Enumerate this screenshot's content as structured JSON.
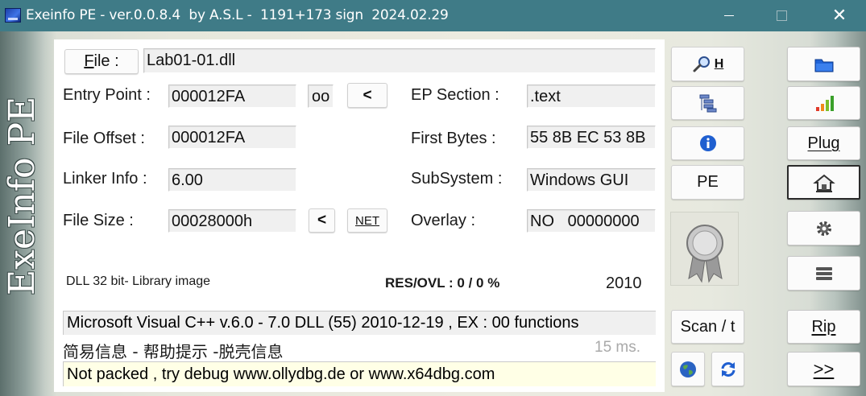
{
  "window": {
    "title": "Exeinfo PE - ver.0.0.8.4  by A.S.L -  1191+173 sign  2024.02.29",
    "controls": {
      "minimize": "minimize",
      "maximize": "maximize",
      "close": "✕"
    }
  },
  "logo_text": "ExeInfo PE",
  "file": {
    "button_label": "File :",
    "button_hotkey": "F",
    "button_rest": "ile :",
    "path": "Lab01-01.dll"
  },
  "fields": {
    "entry_point": {
      "label": "Entry Point :",
      "value": "000012FA"
    },
    "file_offset": {
      "label": "File Offset :",
      "value": "000012FA"
    },
    "linker_info": {
      "label": "Linker Info :",
      "value": "6.00"
    },
    "file_size": {
      "label": "File Size :",
      "value": "00028000h"
    },
    "ep_section": {
      "label": "EP Section :",
      "value": ".text"
    },
    "first_bytes": {
      "label": "First Bytes :",
      "value": "55 8B EC 53 8B"
    },
    "subsystem": {
      "label": "SubSystem :",
      "value": "Windows GUI"
    },
    "overlay": {
      "label": "Overlay :",
      "value": "NO   00000000"
    }
  },
  "inline_buttons": {
    "oo": "oo",
    "ep_back": "<",
    "size_back": "<",
    "net": "NET"
  },
  "info": {
    "image_type": "DLL 32 bit- Library image",
    "res_ovl": "RES/OVL : 0 / 0 %",
    "year": "2010",
    "scan_result": "Microsoft Visual C++ v.6.0 - 7.0 DLL (55) 2010-12-19  , EX : 00 functions",
    "hint_caption": "简易信息 - 帮助提示 -脱壳信息",
    "scan_time": "15 ms.",
    "hint": "Not packed , try debug www.ollydbg.de or www.x64dbg.com"
  },
  "mid_buttons": {
    "search_hotkey": "H",
    "pe": "PE",
    "scan": "Scan / t"
  },
  "right_buttons": {
    "plug": "Plug",
    "rip": "Rip",
    "next": ">>"
  },
  "colors": {
    "titlebar": "#3f7b87",
    "hint_background": "#ffffe6",
    "field_background": "#f0f0f0"
  },
  "icons": [
    "app-icon",
    "magnifier-icon",
    "list-icon",
    "info-icon",
    "medal-icon",
    "globe-icon",
    "refresh-icon",
    "folder-icon",
    "signal-bars-icon",
    "home-icon",
    "gear-icon",
    "menu-icon"
  ]
}
